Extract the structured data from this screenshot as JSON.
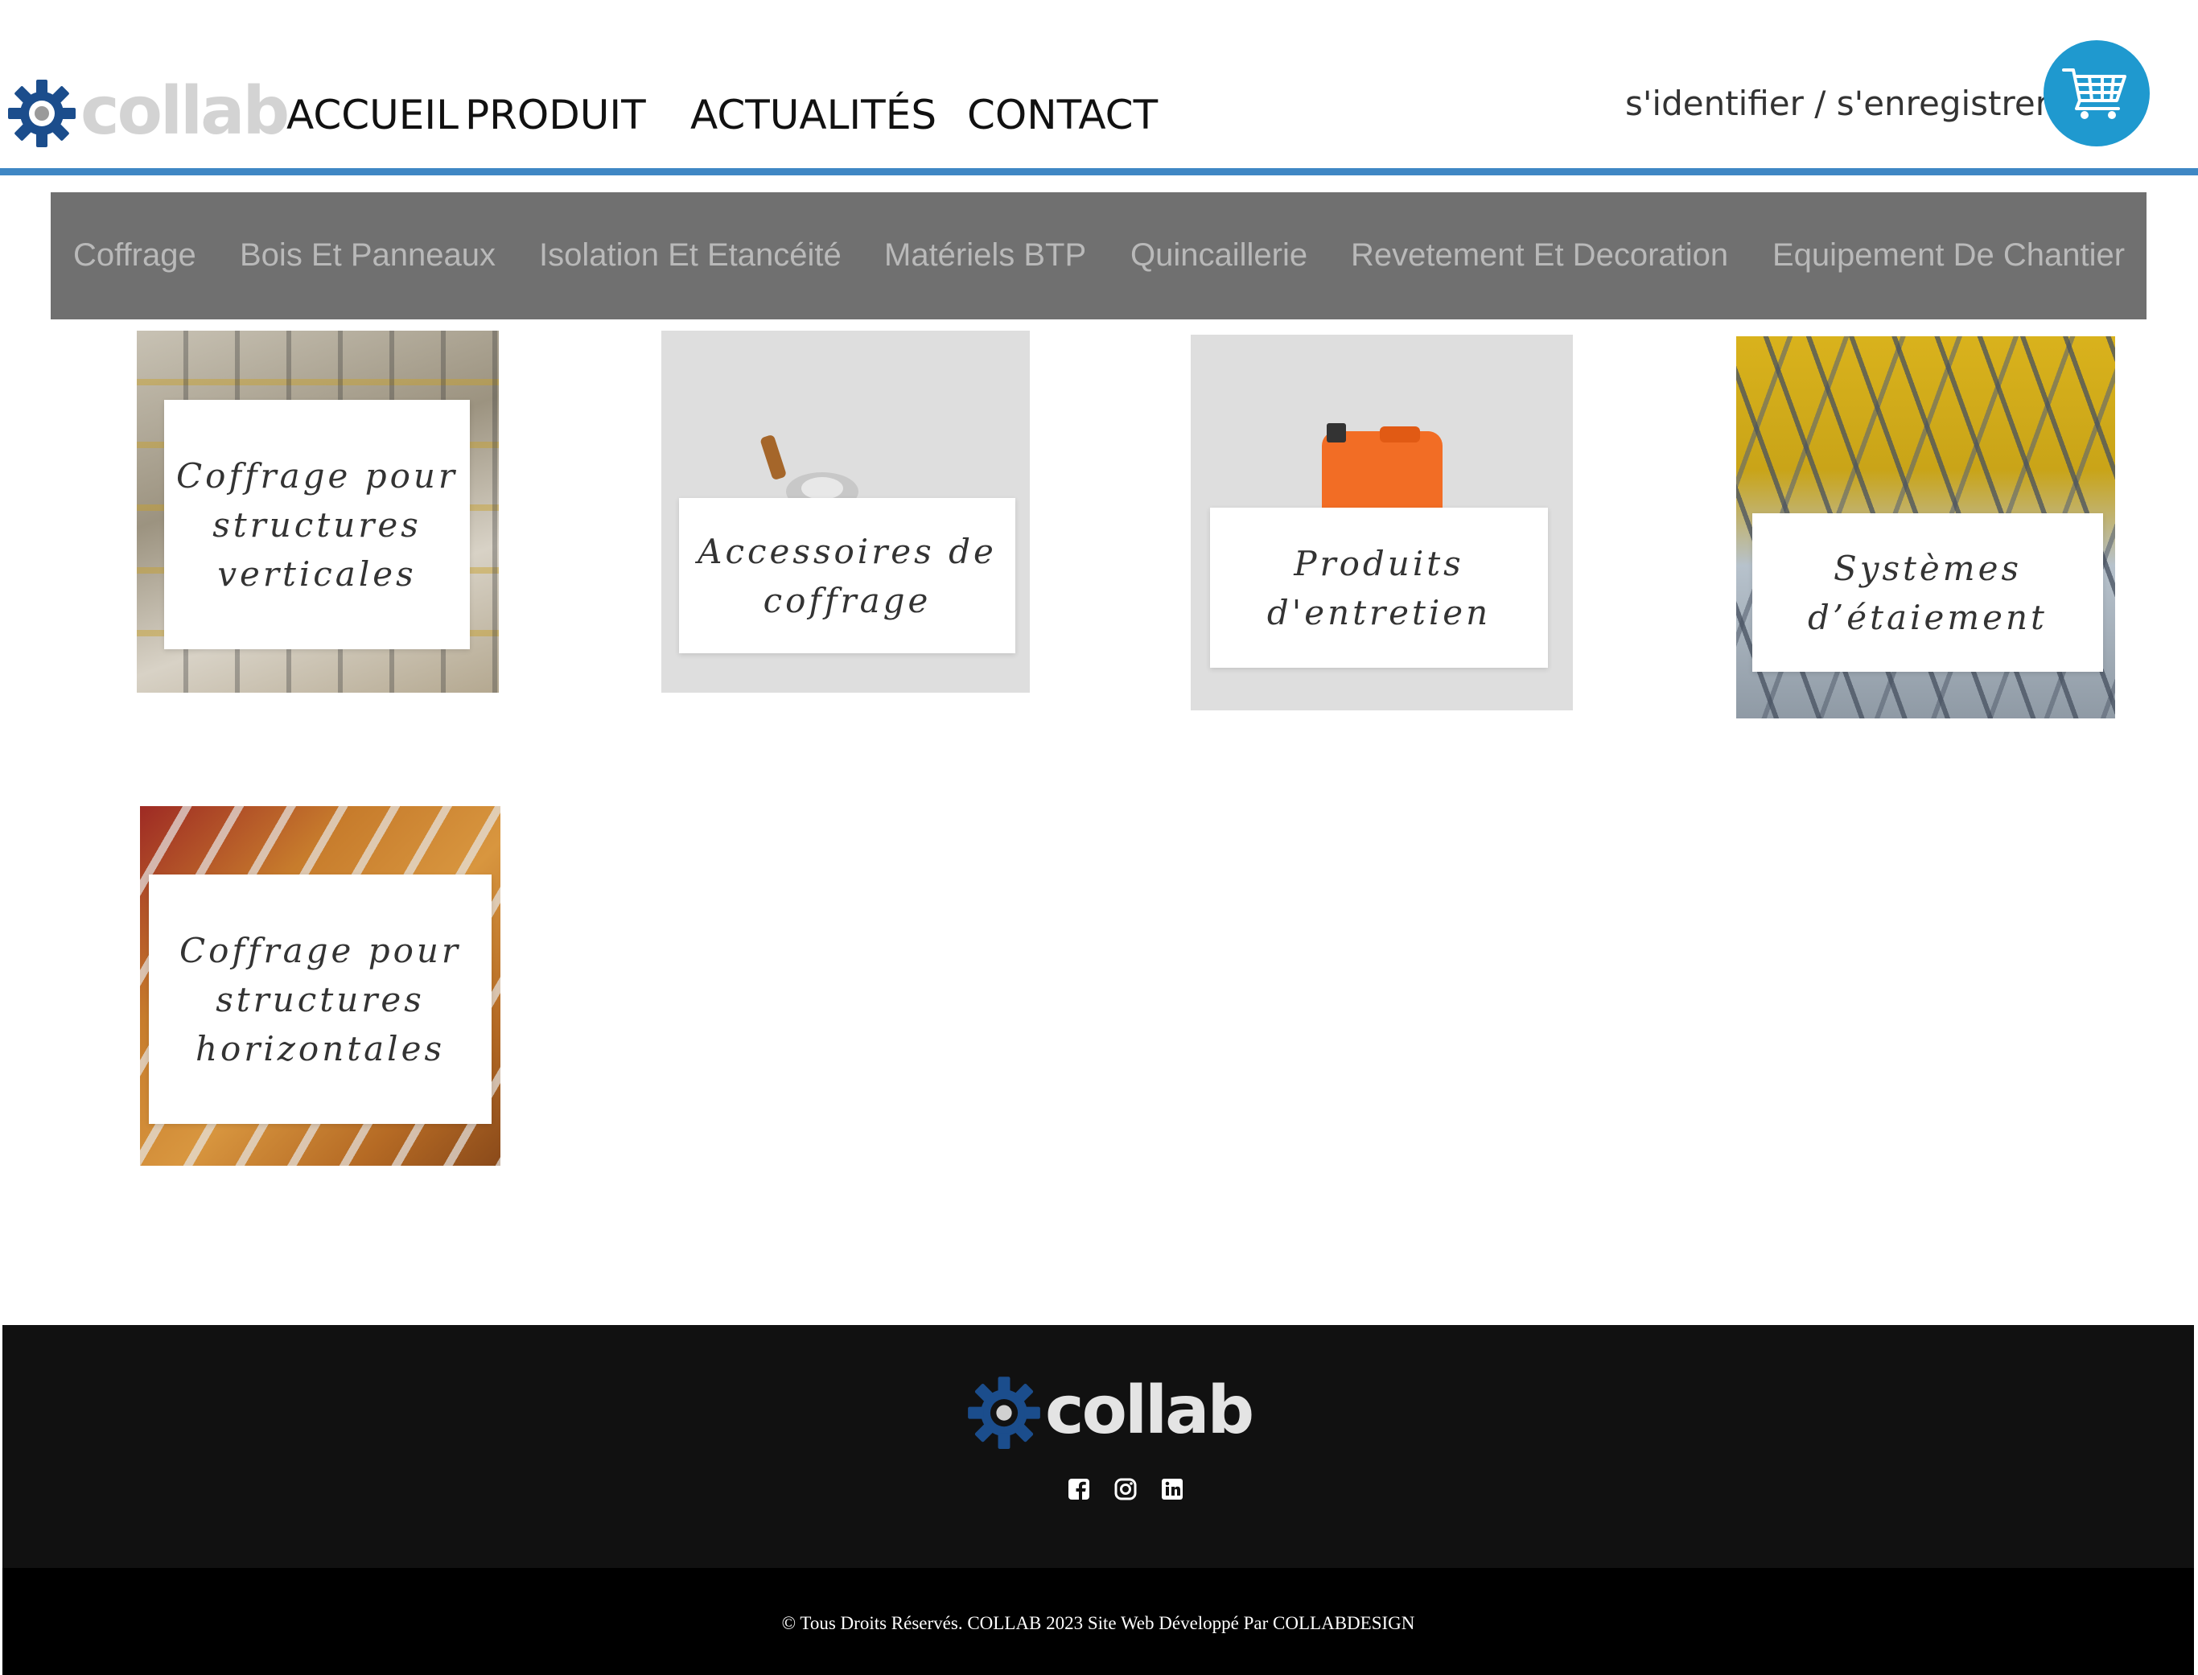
{
  "brand": {
    "name": "collab",
    "gear_color": "#1b4d8c",
    "accent_color": "#3f87c4"
  },
  "nav": {
    "items": [
      {
        "label": "ACCUEIL"
      },
      {
        "label": "PRODUIT"
      },
      {
        "label": "ACTUALITÉS"
      },
      {
        "label": "CONTACT"
      }
    ],
    "auth_label": "s'identifier / s'enregistrer",
    "cart_icon": "shopping-cart-icon",
    "cart_color": "#1f99cf"
  },
  "categories": [
    {
      "label": "Coffrage"
    },
    {
      "label": "Bois Et Panneaux"
    },
    {
      "label": "Isolation Et Etancéité"
    },
    {
      "label": "Matériels BTP"
    },
    {
      "label": "Quincaillerie"
    },
    {
      "label": "Revetement Et Decoration"
    },
    {
      "label": "Equipement De Chantier"
    }
  ],
  "products": [
    {
      "title": "Coffrage pour structures verticales"
    },
    {
      "title": "Accessoires de coffrage"
    },
    {
      "title": "Produits d'entretien"
    },
    {
      "title": "Systèmes d’étaiement"
    },
    {
      "title": "Coffrage pour structures horizontales"
    }
  ],
  "footer": {
    "brand_name": "collab",
    "social_icons": [
      "facebook-icon",
      "instagram-icon",
      "linkedin-icon"
    ],
    "copyright": "© Tous Droits Réservés. COLLAB 2023 Site Web Développé Par COLLABDESIGN"
  }
}
